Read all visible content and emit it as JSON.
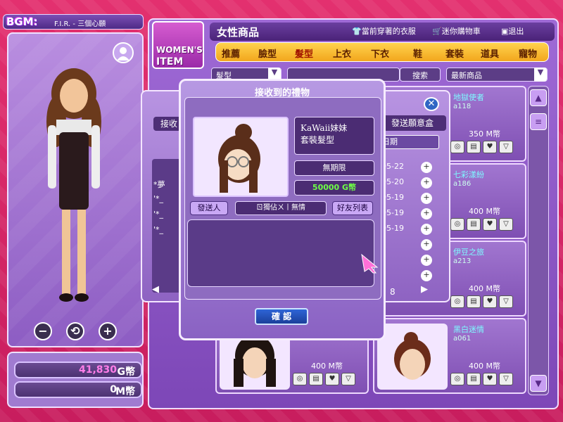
{
  "bgm": {
    "label": "BGM:",
    "song": "F.I.R. - 三個心願"
  },
  "character": {
    "zoom_out": "−",
    "rotate": "⟲",
    "zoom_in": "+"
  },
  "money": {
    "g_value": "41,830",
    "g_unit": "G幣",
    "m_value": "0",
    "m_unit": "M幣"
  },
  "shop": {
    "logo_line1": "WOMEN'S",
    "logo_line2": "ITEM",
    "title": "女性商品",
    "links": [
      {
        "label": "當前穿著的衣服"
      },
      {
        "label": "迷你購物車"
      },
      {
        "label": "退出"
      }
    ],
    "tabs": [
      "推薦",
      "臉型",
      "髮型",
      "上衣",
      "下衣",
      "鞋",
      "套裝",
      "道具",
      "寵物"
    ],
    "filter_category": "髮型",
    "search_label": "搜索",
    "sort": "最新商品"
  },
  "items": [
    {
      "title": "地獄使者",
      "user": "a118",
      "price": "350 M幣"
    },
    {
      "title": "七彩漾紛",
      "user": "a186",
      "price": "400 M幣"
    },
    {
      "title": "伊豆之旅",
      "user": "a213",
      "price": "400 M幣"
    },
    {
      "title": "黑白迷情",
      "user": "a061",
      "price": "400 M幣"
    },
    {
      "title": "",
      "user": "",
      "price": "400 M幣"
    },
    {
      "title": "",
      "user": "",
      "price": "400 M幣"
    }
  ],
  "wish_dialog": {
    "left_title": "接收",
    "left_rows": [
      "*夢",
      "'*_",
      "'*_",
      "'*_"
    ],
    "right_title": "發送願意盒",
    "date_header": "日期",
    "dates": [
      "05-22",
      "05-20",
      "05-19",
      "05-19",
      "05-19"
    ],
    "page": "8",
    "close": "✕"
  },
  "gift_dialog": {
    "title": "接收到的禮物",
    "item_name": "KaWaii妹妹\n套裝髮型",
    "expiry": "無期限",
    "price": "50000 G幣",
    "send_label": "發送人",
    "sender_name": "ㄖ獨佔ㄨ丨無情",
    "friends_label": "好友列表",
    "confirm": "確 認"
  },
  "colors": {
    "accent": "#ffcc33",
    "panel": "#8d5dc3",
    "price_green": "#6dff45",
    "link_cyan": "#7ef9ff"
  }
}
